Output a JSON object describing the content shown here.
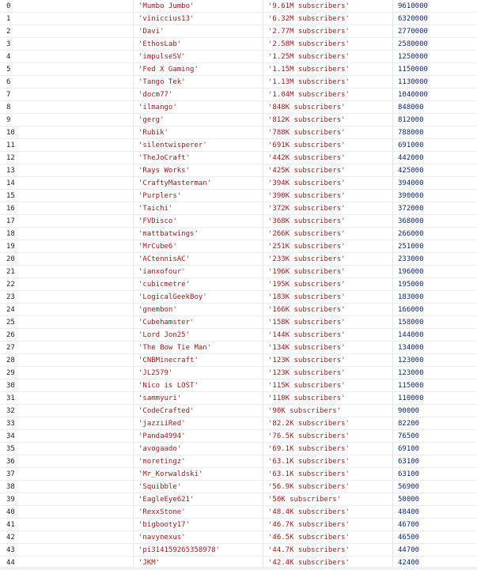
{
  "table": {
    "rows": [
      {
        "idx": "0",
        "name": "'Mumbo Jumbo'",
        "subs": "'9.61M subscribers'",
        "count": "9610000"
      },
      {
        "idx": "1",
        "name": "'viniccius13'",
        "subs": "'6.32M subscribers'",
        "count": "6320000"
      },
      {
        "idx": "2",
        "name": "'Davi'",
        "subs": "'2.77M subscribers'",
        "count": "2770000"
      },
      {
        "idx": "3",
        "name": "'EthosLab'",
        "subs": "'2.58M subscribers'",
        "count": "2580000"
      },
      {
        "idx": "4",
        "name": "'impulseSV'",
        "subs": "'1.25M subscribers'",
        "count": "1250000"
      },
      {
        "idx": "5",
        "name": "'Fed X Gaming'",
        "subs": "'1.15M subscribers'",
        "count": "1150000"
      },
      {
        "idx": "6",
        "name": "'Tango Tek'",
        "subs": "'1.13M subscribers'",
        "count": "1130000"
      },
      {
        "idx": "7",
        "name": "'docm77'",
        "subs": "'1.04M subscribers'",
        "count": "1040000"
      },
      {
        "idx": "8",
        "name": "'ilmango'",
        "subs": "'848K subscribers'",
        "count": "848000"
      },
      {
        "idx": "9",
        "name": "'gerg'",
        "subs": "'812K subscribers'",
        "count": "812000"
      },
      {
        "idx": "10",
        "name": "'Rubik'",
        "subs": "'788K subscribers'",
        "count": "788000"
      },
      {
        "idx": "11",
        "name": "'silentwisperer'",
        "subs": "'691K subscribers'",
        "count": "691000"
      },
      {
        "idx": "12",
        "name": "'TheJoCraft'",
        "subs": "'442K subscribers'",
        "count": "442000"
      },
      {
        "idx": "13",
        "name": "'Rays Works'",
        "subs": "'425K subscribers'",
        "count": "425000"
      },
      {
        "idx": "14",
        "name": "'CraftyMasterman'",
        "subs": "'394K subscribers'",
        "count": "394000"
      },
      {
        "idx": "15",
        "name": "'Purplers'",
        "subs": "'390K subscribers'",
        "count": "390000"
      },
      {
        "idx": "16",
        "name": "'Taichi'",
        "subs": "'372K subscribers'",
        "count": "372000"
      },
      {
        "idx": "17",
        "name": "'FVDisco'",
        "subs": "'368K subscribers'",
        "count": "368000"
      },
      {
        "idx": "18",
        "name": "'mattbatwings'",
        "subs": "'266K subscribers'",
        "count": "266000"
      },
      {
        "idx": "19",
        "name": "'MrCube6'",
        "subs": "'251K subscribers'",
        "count": "251000"
      },
      {
        "idx": "20",
        "name": "'ACtennisAC'",
        "subs": "'233K subscribers'",
        "count": "233000"
      },
      {
        "idx": "21",
        "name": "'ianxofour'",
        "subs": "'196K subscribers'",
        "count": "196000"
      },
      {
        "idx": "22",
        "name": "'cubicmetre'",
        "subs": "'195K subscribers'",
        "count": "195000"
      },
      {
        "idx": "23",
        "name": "'LogicalGeekBoy'",
        "subs": "'183K subscribers'",
        "count": "183000"
      },
      {
        "idx": "24",
        "name": "'gnembon'",
        "subs": "'166K subscribers'",
        "count": "166000"
      },
      {
        "idx": "25",
        "name": "'Cubehamster'",
        "subs": "'158K subscribers'",
        "count": "158000"
      },
      {
        "idx": "26",
        "name": "'Lord Jon25'",
        "subs": "'144K subscribers'",
        "count": "144000"
      },
      {
        "idx": "27",
        "name": "'The Bow Tie Man'",
        "subs": "'134K subscribers'",
        "count": "134000"
      },
      {
        "idx": "28",
        "name": "'CNBMinecraft'",
        "subs": "'123K subscribers'",
        "count": "123000"
      },
      {
        "idx": "29",
        "name": "'JL2579'",
        "subs": "'123K subscribers'",
        "count": "123000"
      },
      {
        "idx": "30",
        "name": "'Nico is LOST'",
        "subs": "'115K subscribers'",
        "count": "115000"
      },
      {
        "idx": "31",
        "name": "'sammyuri'",
        "subs": "'110K subscribers'",
        "count": "110000"
      },
      {
        "idx": "32",
        "name": "'CodeCrafted'",
        "subs": "'90K subscribers'",
        "count": "90000"
      },
      {
        "idx": "33",
        "name": "'jazziiRed'",
        "subs": "'82.2K subscribers'",
        "count": "82200"
      },
      {
        "idx": "34",
        "name": "'Panda4994'",
        "subs": "'76.5K subscribers'",
        "count": "76500"
      },
      {
        "idx": "35",
        "name": "'avogaado'",
        "subs": "'69.1K subscribers'",
        "count": "69100"
      },
      {
        "idx": "36",
        "name": "'moretingz'",
        "subs": "'63.1K subscribers'",
        "count": "63100"
      },
      {
        "idx": "37",
        "name": "'Mr_Korwaldski'",
        "subs": "'63.1K subscribers'",
        "count": "63100"
      },
      {
        "idx": "38",
        "name": "'Squibble'",
        "subs": "'56.9K subscribers'",
        "count": "56900"
      },
      {
        "idx": "39",
        "name": "'EagleEye621'",
        "subs": "'50K subscribers'",
        "count": "50000"
      },
      {
        "idx": "40",
        "name": "'RexxStone'",
        "subs": "'48.4K subscribers'",
        "count": "48400"
      },
      {
        "idx": "41",
        "name": "'bigbooty17'",
        "subs": "'46.7K subscribers'",
        "count": "46700"
      },
      {
        "idx": "42",
        "name": "'navynexus'",
        "subs": "'46.5K subscribers'",
        "count": "46500"
      },
      {
        "idx": "43",
        "name": "'pi314159265358978'",
        "subs": "'44.7K subscribers'",
        "count": "44700"
      },
      {
        "idx": "44",
        "name": "'JKM'",
        "subs": "'42.4K subscribers'",
        "count": "42400"
      }
    ]
  },
  "colors": {
    "string_text": "#a31515",
    "number_text": "#0b2a6f",
    "index_text": "#1f1f1f",
    "row_divider": "#e6ecf2"
  }
}
